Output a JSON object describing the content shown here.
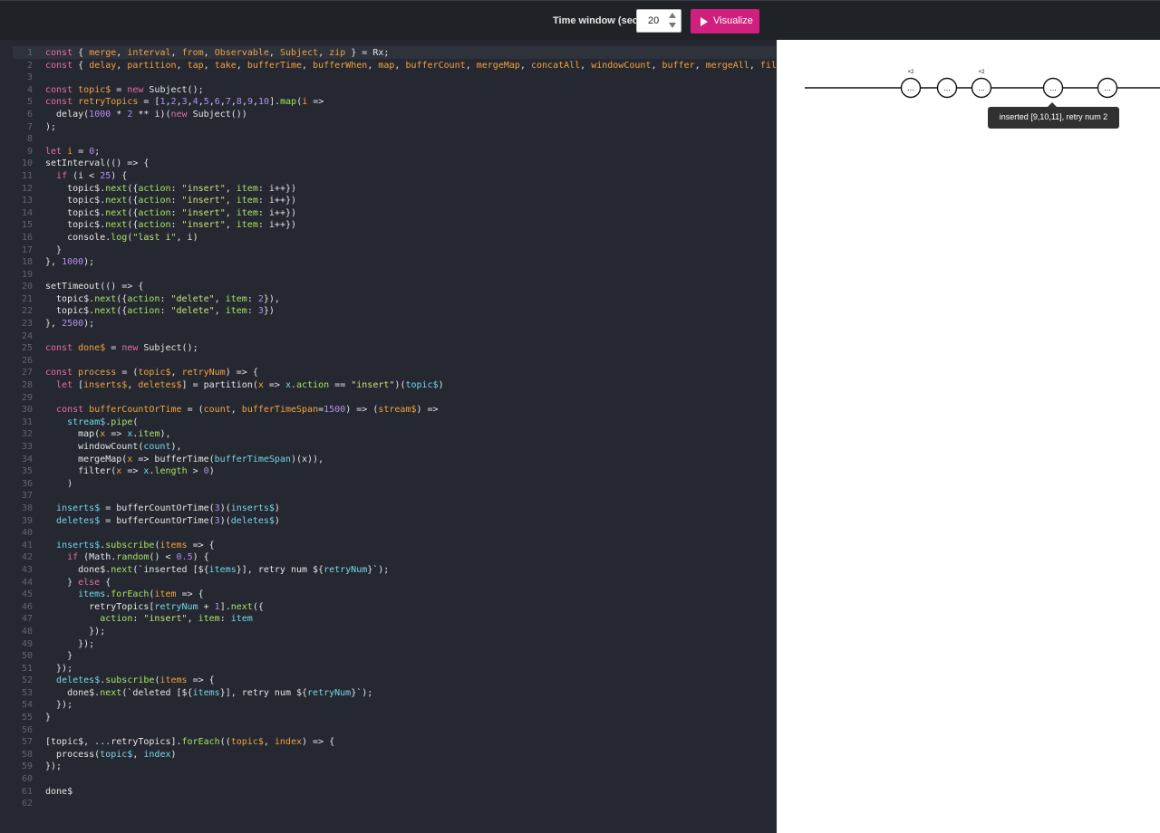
{
  "toolbar": {
    "time_window_label": "Time window (sec)",
    "time_window_value": "20",
    "visualize_label": "Visualize",
    "visualize_color": "#d01f7e"
  },
  "editor": {
    "lines": [
      [
        [
          "kw",
          "const"
        ],
        [
          "",
          "{ "
        ],
        [
          "vd",
          "merge"
        ],
        [
          "",
          ", "
        ],
        [
          "vd",
          "interval"
        ],
        [
          "",
          ", "
        ],
        [
          "vd",
          "from"
        ],
        [
          "",
          ", "
        ],
        [
          "vd",
          "Observable"
        ],
        [
          "",
          ", "
        ],
        [
          "vd",
          "Subject"
        ],
        [
          "",
          ", "
        ],
        [
          "vd",
          "zip"
        ],
        [
          "",
          " } = Rx;"
        ]
      ],
      [
        [
          "kw",
          "const"
        ],
        [
          "",
          "{ "
        ],
        [
          "vd",
          "delay"
        ],
        [
          "",
          ", "
        ],
        [
          "vd",
          "partition"
        ],
        [
          "",
          ", "
        ],
        [
          "vd",
          "tap"
        ],
        [
          "",
          ", "
        ],
        [
          "vd",
          "take"
        ],
        [
          "",
          ", "
        ],
        [
          "vd",
          "bufferTime"
        ],
        [
          "",
          ", "
        ],
        [
          "vd",
          "bufferWhen"
        ],
        [
          "",
          ", "
        ],
        [
          "vd",
          "map"
        ],
        [
          "",
          ", "
        ],
        [
          "vd",
          "bufferCount"
        ],
        [
          "",
          ", "
        ],
        [
          "vd",
          "mergeMap"
        ],
        [
          "",
          ", "
        ],
        [
          "vd",
          "concatAll"
        ],
        [
          "",
          ", "
        ],
        [
          "vd",
          "windowCount"
        ],
        [
          "",
          ", "
        ],
        [
          "vd",
          "buffer"
        ],
        [
          "",
          ", "
        ],
        [
          "vd",
          "mergeAll"
        ],
        [
          "",
          ", "
        ],
        [
          "vd",
          "fil"
        ]
      ],
      [],
      [
        [
          "kw",
          "const"
        ],
        [
          "vd",
          "topic$"
        ],
        [
          "",
          " = "
        ],
        [
          "kw",
          "new"
        ],
        [
          "",
          " Subject();"
        ]
      ],
      [
        [
          "kw",
          "const"
        ],
        [
          "vd",
          "retryTopics"
        ],
        [
          "",
          " = ["
        ],
        [
          "nu",
          "1"
        ],
        [
          "",
          ","
        ],
        [
          "nu",
          "2"
        ],
        [
          "",
          ","
        ],
        [
          "nu",
          "3"
        ],
        [
          "",
          ","
        ],
        [
          "nu",
          "4"
        ],
        [
          "",
          ","
        ],
        [
          "nu",
          "5"
        ],
        [
          "",
          ","
        ],
        [
          "nu",
          "6"
        ],
        [
          "",
          ","
        ],
        [
          "nu",
          "7"
        ],
        [
          "",
          ","
        ],
        [
          "nu",
          "8"
        ],
        [
          "",
          ","
        ],
        [
          "nu",
          "9"
        ],
        [
          "",
          ","
        ],
        [
          "nu",
          "10"
        ],
        [
          "",
          "]."
        ],
        [
          "pr",
          "map"
        ],
        [
          "",
          "("
        ],
        [
          "vd",
          "i"
        ],
        [
          "",
          " =>"
        ]
      ],
      [
        [
          "",
          "  delay("
        ],
        [
          "nu",
          "1000"
        ],
        [
          "",
          " * "
        ],
        [
          "nu",
          "2"
        ],
        [
          "",
          " ** i)("
        ],
        [
          "kw",
          "new"
        ],
        [
          "",
          " Subject())"
        ]
      ],
      [
        [
          "",
          ");"
        ]
      ],
      [],
      [
        [
          "kw",
          "let"
        ],
        [
          "vd",
          "i"
        ],
        [
          "",
          " = "
        ],
        [
          "nu",
          "0"
        ],
        [
          "",
          ";"
        ]
      ],
      [
        [
          "",
          "setInterval(() => {"
        ]
      ],
      [
        [
          "",
          "  "
        ],
        [
          "kw",
          "if"
        ],
        [
          "",
          " (i < "
        ],
        [
          "nu",
          "25"
        ],
        [
          "",
          ") {"
        ]
      ],
      [
        [
          "",
          "    topic$."
        ],
        [
          "pr",
          "next"
        ],
        [
          "",
          "({"
        ],
        [
          "pr",
          "action"
        ],
        [
          "",
          ": "
        ],
        [
          "st",
          "\"insert\""
        ],
        [
          "",
          ", "
        ],
        [
          "pr",
          "item"
        ],
        [
          "",
          ": i++})"
        ]
      ],
      [
        [
          "",
          "    topic$."
        ],
        [
          "pr",
          "next"
        ],
        [
          "",
          "({"
        ],
        [
          "pr",
          "action"
        ],
        [
          "",
          ": "
        ],
        [
          "st",
          "\"insert\""
        ],
        [
          "",
          ", "
        ],
        [
          "pr",
          "item"
        ],
        [
          "",
          ": i++})"
        ]
      ],
      [
        [
          "",
          "    topic$."
        ],
        [
          "pr",
          "next"
        ],
        [
          "",
          "({"
        ],
        [
          "pr",
          "action"
        ],
        [
          "",
          ": "
        ],
        [
          "st",
          "\"insert\""
        ],
        [
          "",
          ", "
        ],
        [
          "pr",
          "item"
        ],
        [
          "",
          ": i++})"
        ]
      ],
      [
        [
          "",
          "    topic$."
        ],
        [
          "pr",
          "next"
        ],
        [
          "",
          "({"
        ],
        [
          "pr",
          "action"
        ],
        [
          "",
          ": "
        ],
        [
          "st",
          "\"insert\""
        ],
        [
          "",
          ", "
        ],
        [
          "pr",
          "item"
        ],
        [
          "",
          ": i++})"
        ]
      ],
      [
        [
          "",
          "    console."
        ],
        [
          "pr",
          "log"
        ],
        [
          "",
          "("
        ],
        [
          "st",
          "\"last i\""
        ],
        [
          "",
          ", i)"
        ]
      ],
      [
        [
          "",
          "  }"
        ]
      ],
      [
        [
          "",
          "}, "
        ],
        [
          "nu",
          "1000"
        ],
        [
          "",
          ");"
        ]
      ],
      [],
      [
        [
          "",
          "setTimeout(() => {"
        ]
      ],
      [
        [
          "",
          "  topic$."
        ],
        [
          "pr",
          "next"
        ],
        [
          "",
          "({"
        ],
        [
          "pr",
          "action"
        ],
        [
          "",
          ": "
        ],
        [
          "st",
          "\"delete\""
        ],
        [
          "",
          ", "
        ],
        [
          "pr",
          "item"
        ],
        [
          "",
          ": "
        ],
        [
          "nu",
          "2"
        ],
        [
          "",
          "}),"
        ]
      ],
      [
        [
          "",
          "  topic$."
        ],
        [
          "pr",
          "next"
        ],
        [
          "",
          "({"
        ],
        [
          "pr",
          "action"
        ],
        [
          "",
          ": "
        ],
        [
          "st",
          "\"delete\""
        ],
        [
          "",
          ", "
        ],
        [
          "pr",
          "item"
        ],
        [
          "",
          ": "
        ],
        [
          "nu",
          "3"
        ],
        [
          "",
          "})"
        ]
      ],
      [
        [
          "",
          "}, "
        ],
        [
          "nu",
          "2500"
        ],
        [
          "",
          ");"
        ]
      ],
      [],
      [
        [
          "kw",
          "const"
        ],
        [
          "vd",
          "done$"
        ],
        [
          "",
          " = "
        ],
        [
          "kw",
          "new"
        ],
        [
          "",
          " Subject();"
        ]
      ],
      [],
      [
        [
          "kw",
          "const"
        ],
        [
          "vd",
          "process"
        ],
        [
          "",
          " = ("
        ],
        [
          "vd",
          "topic$"
        ],
        [
          "",
          ", "
        ],
        [
          "vd",
          "retryNum"
        ],
        [
          "",
          ") => {"
        ]
      ],
      [
        [
          "",
          "  "
        ],
        [
          "kw",
          "let"
        ],
        [
          "",
          " ["
        ],
        [
          "vd",
          "inserts$"
        ],
        [
          "",
          ", "
        ],
        [
          "vd",
          "deletes$"
        ],
        [
          "",
          "] = partition("
        ],
        [
          "vd",
          "x"
        ],
        [
          "",
          " => "
        ],
        [
          "fn",
          "x"
        ],
        [
          "",
          "."
        ],
        [
          "pr",
          "action"
        ],
        [
          "",
          " == "
        ],
        [
          "st",
          "\"insert\""
        ],
        [
          "",
          ")("
        ],
        [
          "fn",
          "topic$"
        ],
        [
          "",
          ")"
        ]
      ],
      [],
      [
        [
          "",
          "  "
        ],
        [
          "kw",
          "const"
        ],
        [
          "vd",
          "bufferCountOrTime"
        ],
        [
          "",
          " = ("
        ],
        [
          "vd",
          "count"
        ],
        [
          "",
          ", "
        ],
        [
          "vd",
          "bufferTimeSpan"
        ],
        [
          "",
          "="
        ],
        [
          "nu",
          "1500"
        ],
        [
          "",
          ") => ("
        ],
        [
          "vd",
          "stream$"
        ],
        [
          "",
          ") =>"
        ]
      ],
      [
        [
          "",
          "    "
        ],
        [
          "fn",
          "stream$"
        ],
        [
          "",
          "."
        ],
        [
          "pr",
          "pipe"
        ],
        [
          "",
          "("
        ]
      ],
      [
        [
          "",
          "      map("
        ],
        [
          "vd",
          "x"
        ],
        [
          "",
          " => "
        ],
        [
          "fn",
          "x"
        ],
        [
          "",
          "."
        ],
        [
          "pr",
          "item"
        ],
        [
          "",
          "),"
        ]
      ],
      [
        [
          "",
          "      windowCount("
        ],
        [
          "fn",
          "count"
        ],
        [
          "",
          "),"
        ]
      ],
      [
        [
          "",
          "      mergeMap("
        ],
        [
          "vd",
          "x"
        ],
        [
          "",
          " => bufferTime("
        ],
        [
          "fn",
          "bufferTimeSpan"
        ],
        [
          "",
          ")(x)),"
        ]
      ],
      [
        [
          "",
          "      filter("
        ],
        [
          "vd",
          "x"
        ],
        [
          "",
          " => "
        ],
        [
          "fn",
          "x"
        ],
        [
          "",
          "."
        ],
        [
          "pr",
          "length"
        ],
        [
          "",
          " > "
        ],
        [
          "nu",
          "0"
        ],
        [
          "",
          ")"
        ]
      ],
      [
        [
          "",
          "    )"
        ]
      ],
      [],
      [
        [
          "",
          "  "
        ],
        [
          "fn",
          "inserts$"
        ],
        [
          "",
          " = bufferCountOrTime("
        ],
        [
          "nu",
          "3"
        ],
        [
          "",
          ")("
        ],
        [
          "fn",
          "inserts$"
        ],
        [
          "",
          ")"
        ]
      ],
      [
        [
          "",
          "  "
        ],
        [
          "fn",
          "deletes$"
        ],
        [
          "",
          " = bufferCountOrTime("
        ],
        [
          "nu",
          "3"
        ],
        [
          "",
          ")("
        ],
        [
          "fn",
          "deletes$"
        ],
        [
          "",
          ")"
        ]
      ],
      [],
      [
        [
          "",
          "  "
        ],
        [
          "fn",
          "inserts$"
        ],
        [
          "",
          "."
        ],
        [
          "pr",
          "subscribe"
        ],
        [
          "",
          "("
        ],
        [
          "vd",
          "items"
        ],
        [
          "",
          " => {"
        ]
      ],
      [
        [
          "",
          "    "
        ],
        [
          "kw",
          "if"
        ],
        [
          "",
          " (Math."
        ],
        [
          "pr",
          "random"
        ],
        [
          "",
          "() < "
        ],
        [
          "nu",
          "0.5"
        ],
        [
          "",
          ") {"
        ]
      ],
      [
        [
          "",
          "      done$."
        ],
        [
          "pr",
          "next"
        ],
        [
          "",
          "(`inserted [${"
        ],
        [
          "fn",
          "items"
        ],
        [
          "",
          "}], retry num ${"
        ],
        [
          "fn",
          "retryNum"
        ],
        [
          "",
          "}`);"
        ]
      ],
      [
        [
          "",
          "    } "
        ],
        [
          "kw",
          "else"
        ],
        [
          "",
          " {"
        ]
      ],
      [
        [
          "",
          "      "
        ],
        [
          "fn",
          "items"
        ],
        [
          "",
          "."
        ],
        [
          "pr",
          "forEach"
        ],
        [
          "",
          "("
        ],
        [
          "vd",
          "item"
        ],
        [
          "",
          " => {"
        ]
      ],
      [
        [
          "",
          "        retryTopics["
        ],
        [
          "fn",
          "retryNum"
        ],
        [
          "",
          " + "
        ],
        [
          "nu",
          "1"
        ],
        [
          "",
          "]."
        ],
        [
          "pr",
          "next"
        ],
        [
          "",
          "({"
        ]
      ],
      [
        [
          "",
          "          "
        ],
        [
          "pr",
          "action"
        ],
        [
          "",
          ": "
        ],
        [
          "st",
          "\"insert\""
        ],
        [
          "",
          ", "
        ],
        [
          "pr",
          "item"
        ],
        [
          "",
          ": "
        ],
        [
          "fn",
          "item"
        ]
      ],
      [
        [
          "",
          "        });"
        ]
      ],
      [
        [
          "",
          "      });"
        ]
      ],
      [
        [
          "",
          "    }"
        ]
      ],
      [
        [
          "",
          "  });"
        ]
      ],
      [
        [
          "",
          "  "
        ],
        [
          "fn",
          "deletes$"
        ],
        [
          "",
          "."
        ],
        [
          "pr",
          "subscribe"
        ],
        [
          "",
          "("
        ],
        [
          "vd",
          "items"
        ],
        [
          "",
          " => {"
        ]
      ],
      [
        [
          "",
          "    done$."
        ],
        [
          "pr",
          "next"
        ],
        [
          "",
          "(`deleted [${"
        ],
        [
          "fn",
          "items"
        ],
        [
          "",
          "}], retry num ${"
        ],
        [
          "fn",
          "retryNum"
        ],
        [
          "",
          "}`);"
        ]
      ],
      [
        [
          "",
          "  });"
        ]
      ],
      [
        [
          "",
          "}"
        ]
      ],
      [],
      [
        [
          "",
          "[topic$, ...retryTopics]."
        ],
        [
          "pr",
          "forEach"
        ],
        [
          "",
          "(("
        ],
        [
          "vd",
          "topic$"
        ],
        [
          "",
          ", "
        ],
        [
          "vd",
          "index"
        ],
        [
          "",
          ") => {"
        ]
      ],
      [
        [
          "",
          "  process("
        ],
        [
          "fn",
          "topic$"
        ],
        [
          "",
          ", "
        ],
        [
          "fn",
          "index"
        ],
        [
          "",
          ")"
        ]
      ],
      [
        [
          "",
          "});"
        ]
      ],
      [],
      [
        [
          "",
          "done$"
        ]
      ],
      []
    ]
  },
  "marble": {
    "nodes": [
      {
        "label": "...",
        "badge": "×2"
      },
      {
        "label": "...",
        "badge": ""
      },
      {
        "label": "...",
        "badge": "×2"
      },
      {
        "label": "...",
        "badge": ""
      },
      {
        "label": "...",
        "badge": ""
      }
    ],
    "tooltip": "inserted [9,10,11], retry num 2"
  }
}
